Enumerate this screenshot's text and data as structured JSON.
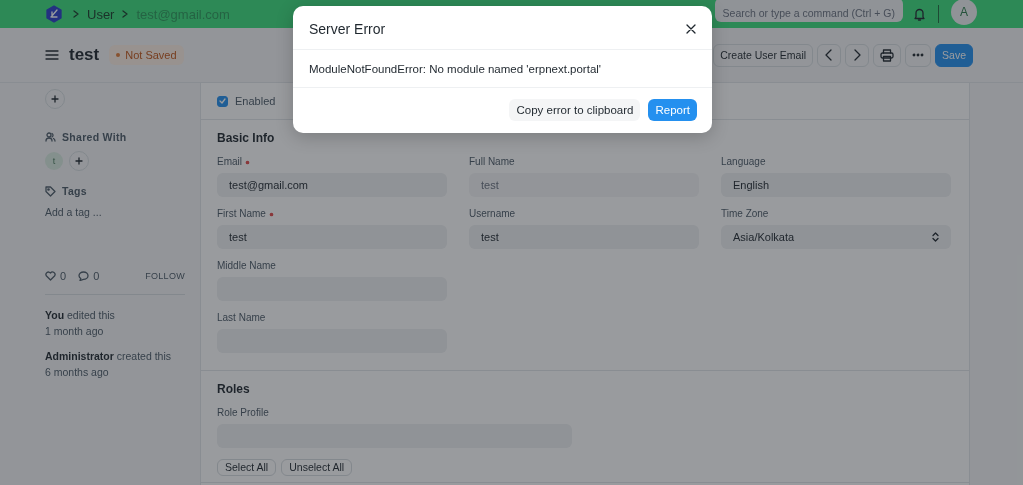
{
  "navbar": {
    "breadcrumbs": [
      "User",
      "test@gmail.com"
    ],
    "search": {
      "placeholder": "Search or type a command (Ctrl + G)"
    },
    "avatar": "A"
  },
  "page_head": {
    "title": "test",
    "indicator": "Not Saved",
    "buttons": [
      {
        "kind": "default",
        "label": "Create User Email"
      },
      {
        "kind": "prev"
      },
      {
        "kind": "next"
      },
      {
        "kind": "print"
      },
      {
        "kind": "more"
      },
      {
        "kind": "primary",
        "label": "Save"
      }
    ]
  },
  "sidebar": {
    "shared_with": {
      "label": "Shared With",
      "users": [
        "t"
      ]
    },
    "tags": {
      "label": "Tags",
      "add_tag": "Add a tag ..."
    },
    "likes": "0",
    "comments": "0",
    "follow": "FOLLOW",
    "timeline": [
      {
        "text": "**You** edited this",
        "time": "1 month ago"
      },
      {
        "text": "**Administrator** created this",
        "time": "6 months ago"
      }
    ]
  },
  "form": {
    "enabled": {
      "label": "Enabled",
      "checked": true
    },
    "sections": [
      {
        "title": "Basic Info",
        "kind": "three-column",
        "columns": [
          [
            {
              "label": "Email",
              "required": true,
              "value": "test@gmail.com",
              "kind": "data"
            },
            {
              "label": "First Name",
              "required": true,
              "value": "test",
              "kind": "data"
            },
            {
              "label": "Middle Name",
              "required": false,
              "kind": "data"
            },
            {
              "label": "Last Name",
              "required": false,
              "kind": "data"
            }
          ],
          [
            {
              "label": "Full Name",
              "required": false,
              "value": "test",
              "kind": "readonly"
            },
            {
              "label": "Username",
              "required": false,
              "value": "test",
              "kind": "data"
            }
          ],
          [
            {
              "label": "Language",
              "required": false,
              "value": "English",
              "kind": "data"
            },
            {
              "label": "Time Zone",
              "required": false,
              "value": "Asia/Kolkata",
              "kind": "select"
            }
          ]
        ]
      },
      {
        "title": "Roles",
        "kind": "two-column",
        "columns": [
          [
            {
              "label": "Role Profile",
              "required": false,
              "kind": "data"
            }
          ]
        ],
        "buttons": [
          "Select All",
          "Unselect All"
        ]
      }
    ]
  },
  "modal": {
    "title": "Server Error",
    "message": "ModuleNotFoundError: No module named 'erpnext.portal'",
    "buttons": [
      {
        "kind": "default",
        "label": "Copy error to clipboard"
      },
      {
        "kind": "primary",
        "label": "Report"
      }
    ]
  }
}
